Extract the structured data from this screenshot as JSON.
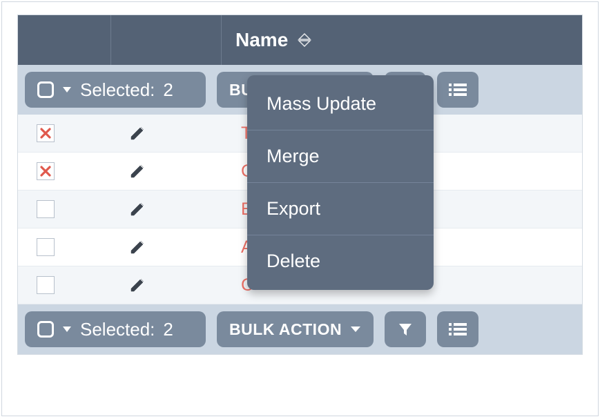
{
  "header": {
    "name_column": "Name"
  },
  "toolbar": {
    "selected_label": "Selected:",
    "selected_count": "2",
    "bulk_action_label": "BULK ACTION"
  },
  "dropdown": {
    "items": [
      {
        "label": "Mass Update"
      },
      {
        "label": "Merge"
      },
      {
        "label": "Export"
      },
      {
        "label": "Delete"
      }
    ]
  },
  "rows": [
    {
      "selected": true,
      "name": "T                                     l Worlds"
    },
    {
      "selected": true,
      "name": "C"
    },
    {
      "selected": false,
      "name": "E                                    is"
    },
    {
      "selected": false,
      "name": "A"
    },
    {
      "selected": false,
      "name": "C"
    }
  ]
}
